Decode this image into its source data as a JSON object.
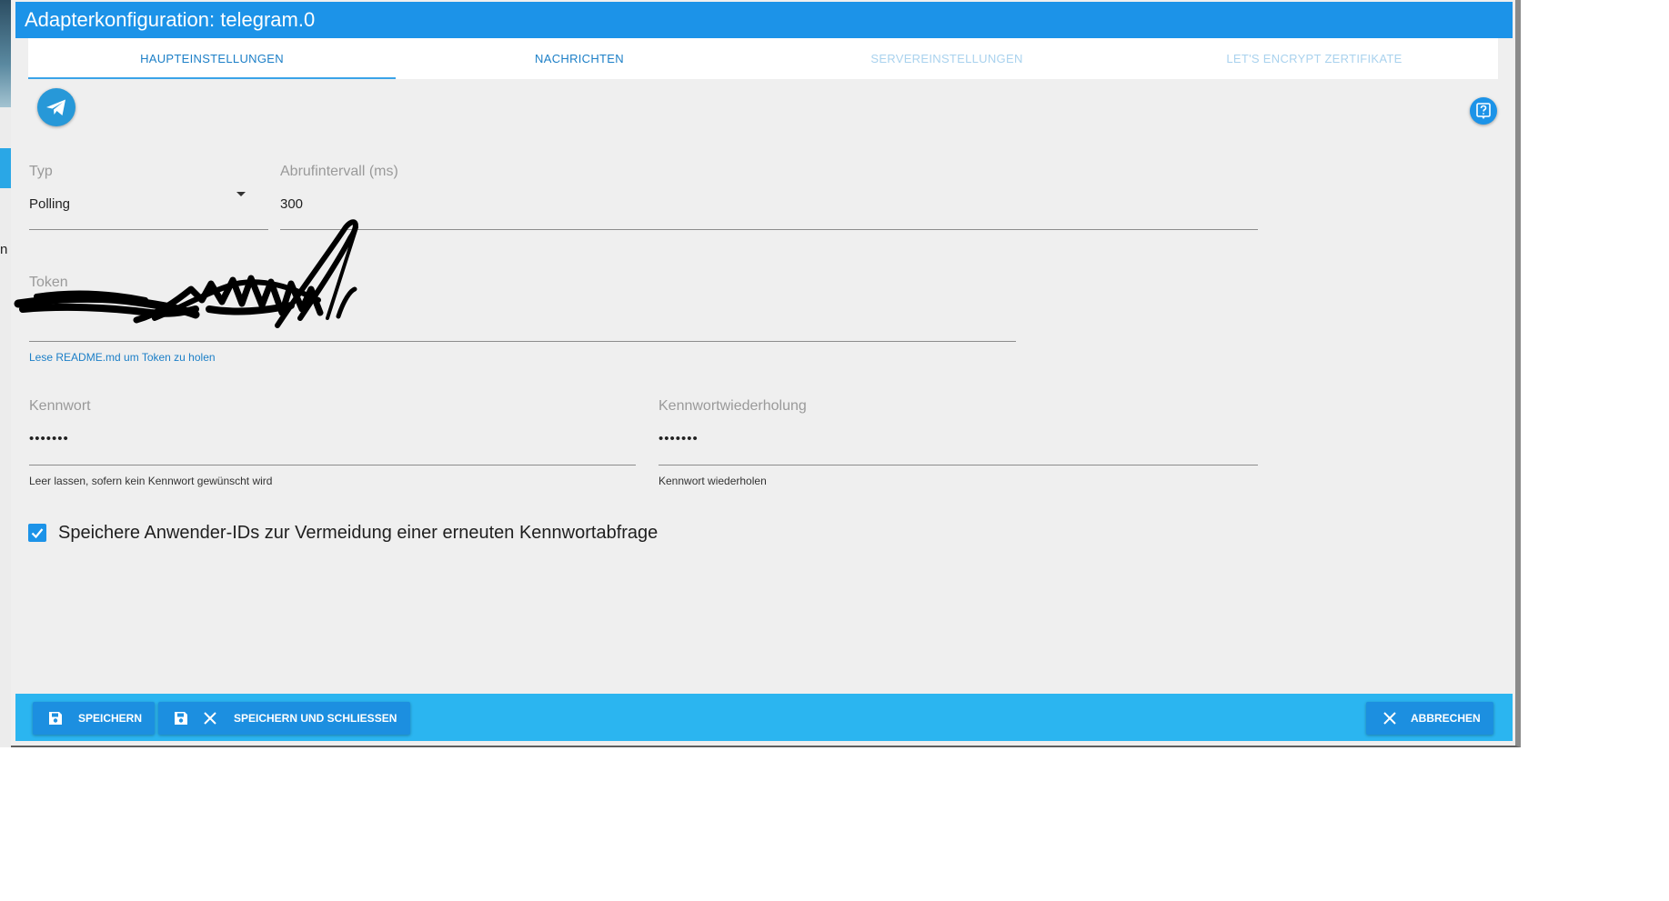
{
  "dialog": {
    "title": "Adapterkonfiguration: telegram.0"
  },
  "tabs": [
    {
      "label": "HAUPTEINSTELLUNGEN",
      "state": "active"
    },
    {
      "label": "NACHRICHTEN",
      "state": "enabled"
    },
    {
      "label": "SERVEREINSTELLUNGEN",
      "state": "disabled"
    },
    {
      "label": "LET'S ENCRYPT ZERTIFIKATE",
      "state": "disabled"
    }
  ],
  "form": {
    "type": {
      "label": "Typ",
      "value": "Polling"
    },
    "interval": {
      "label": "Abrufintervall (ms)",
      "value": "300"
    },
    "token": {
      "label": "Token",
      "value": "",
      "helper": "Lese README.md um Token zu holen"
    },
    "password": {
      "label": "Kennwort",
      "value": "•••••••",
      "helper": "Leer lassen, sofern kein Kennwort gewünscht wird"
    },
    "password_repeat": {
      "label": "Kennwortwiederholung",
      "value": "•••••••",
      "helper": "Kennwort wiederholen"
    },
    "store_ids": {
      "label": "Speichere Anwender-IDs zur Vermeidung einer erneuten Kennwortabfrage",
      "checked": true
    }
  },
  "footer": {
    "save": "SPEICHERN",
    "save_close": "SPEICHERN UND SCHLIESSEN",
    "cancel": "ABBRECHEN"
  },
  "background": {
    "fragment_text": "n"
  },
  "colors": {
    "titlebar": "#1c93e8",
    "footer": "#2bb5f0",
    "button": "#1c8fe0",
    "accent": "#1c7fc7"
  },
  "icons": {
    "logo": "telegram-logo-icon",
    "help": "help-icon",
    "save": "save-icon",
    "close": "close-icon",
    "dropdown": "caret-down-icon",
    "check": "checkmark-icon"
  }
}
